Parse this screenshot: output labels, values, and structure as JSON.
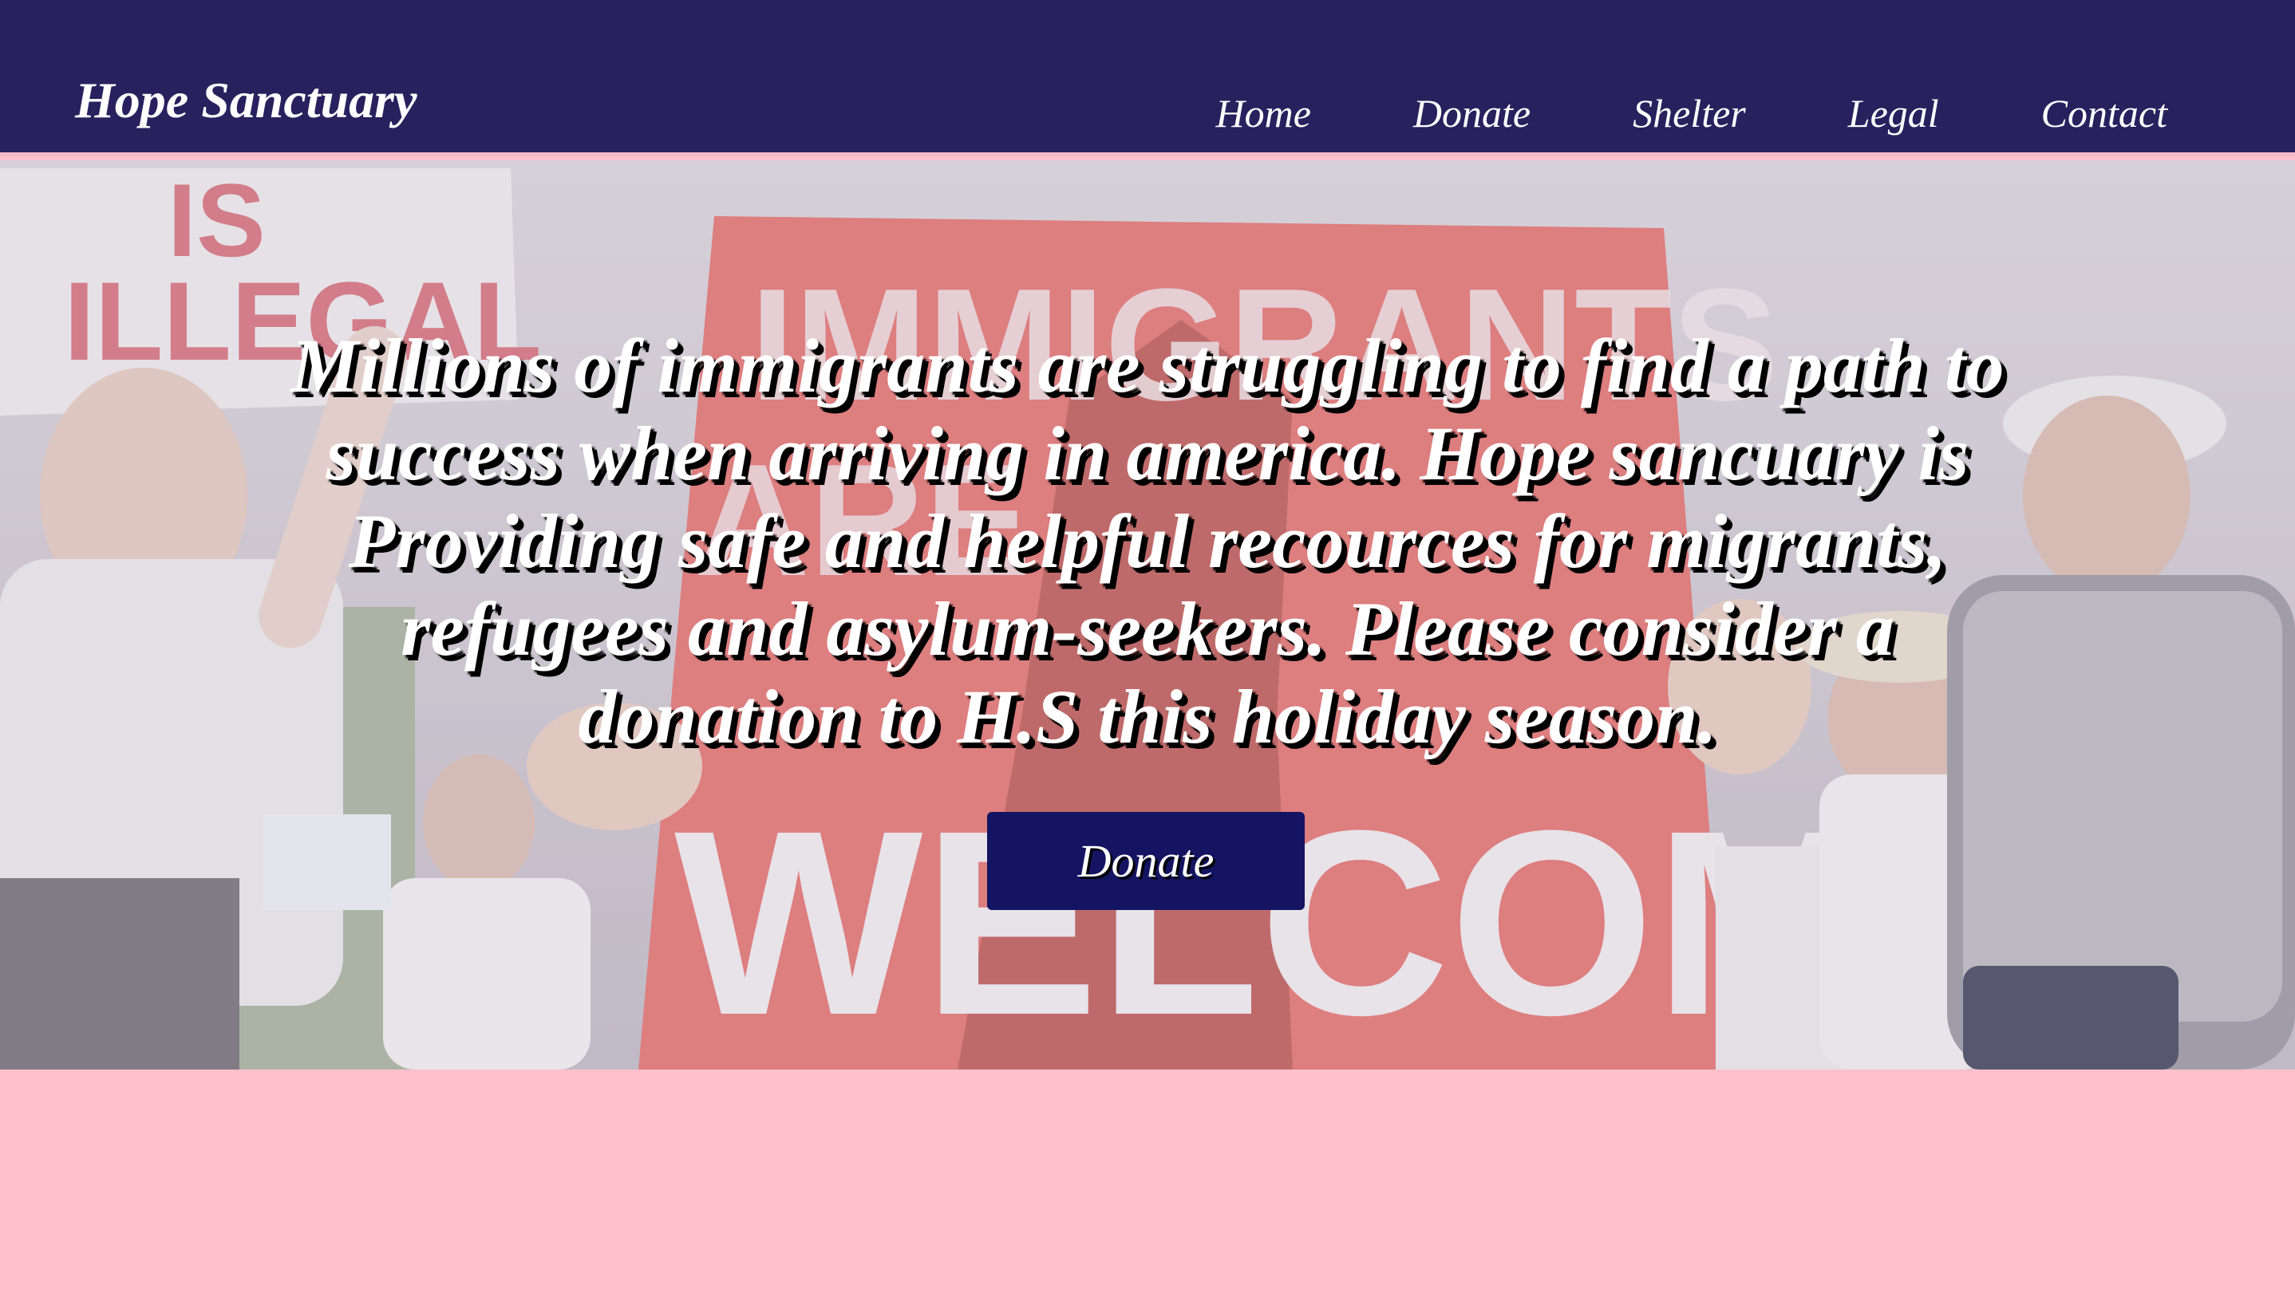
{
  "header": {
    "brand": "Hope Sanctuary",
    "nav": [
      {
        "label": "Home"
      },
      {
        "label": "Donate"
      },
      {
        "label": "Shelter"
      },
      {
        "label": "Legal"
      },
      {
        "label": "Contact"
      }
    ]
  },
  "hero": {
    "message": "Millions of immigrants are struggling to find a path to success when arriving in america. Hope sancuary is Providing safe and helpful recources for migrants, refugees and asylum-seekers. Please consider a donation to H.S this holiday season.",
    "cta_label": "Donate",
    "background_image": {
      "sign_text_top": "IMMIGRANTS",
      "sign_text_mid": "ARE",
      "sign_text_bottom": "WELCOME",
      "left_sign_text_1": "IS",
      "left_sign_text_2": "ILLEGAL"
    }
  },
  "colors": {
    "navbar": "#28215e",
    "page_background": "#ffc0cb",
    "button": "#141463",
    "text": "#ffffff"
  }
}
